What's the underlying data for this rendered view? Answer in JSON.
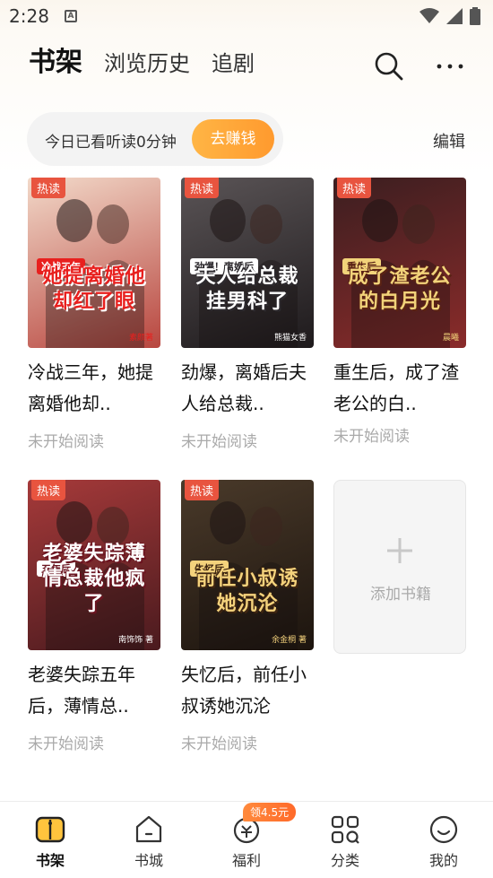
{
  "status_bar": {
    "time": "2:28",
    "notification_letter": "A"
  },
  "header": {
    "tabs": [
      {
        "label": "书架",
        "active": true
      },
      {
        "label": "浏览历史",
        "active": false
      },
      {
        "label": "追剧",
        "active": false
      }
    ],
    "search_icon": "search-icon",
    "more_icon": "more-icon"
  },
  "reading_bar": {
    "text": "今日已看听读0分钟",
    "earn_label": "去赚钱"
  },
  "edit_label": "编辑",
  "books": [
    {
      "badge": "热读",
      "cover_tag": "冷战三年",
      "cover_title": "她提离婚他却红了眼",
      "cover_author": "素颜著",
      "title": "冷战三年，她提离婚他却..",
      "status": "未开始阅读",
      "colors": {
        "bg1": "#f2d9c9",
        "bg2": "#b8463f",
        "title": "#e8201e",
        "stroke": "#ffffff"
      }
    },
    {
      "badge": "热读",
      "cover_tag": "劲爆！离婚后",
      "cover_title": "夫人给总裁挂男科了",
      "cover_author": "熊猫女香",
      "title": "劲爆，离婚后夫人给总裁..",
      "status": "未开始阅读",
      "colors": {
        "bg1": "#5a5456",
        "bg2": "#1e1a1c",
        "title": "#ffffff",
        "stroke": "#2d2a2e"
      }
    },
    {
      "badge": "热读",
      "cover_tag": "重生后",
      "cover_title": "成了渣老公的白月光",
      "cover_author": "晨曦",
      "title": "重生后，成了渣老公的白..",
      "status": "未开始阅读",
      "colors": {
        "bg1": "#3b1e20",
        "bg2": "#8a2b2a",
        "title": "#f2d37a",
        "stroke": "#5a2214"
      }
    },
    {
      "badge": "热读",
      "cover_tag": "五年后",
      "cover_title": "老婆失踪薄情总裁他疯了",
      "cover_author": "南饰饰 著",
      "title": "老婆失踪五年后，薄情总..",
      "status": "未开始阅读",
      "colors": {
        "bg1": "#a63a3a",
        "bg2": "#4a1a1e",
        "title": "#ffffff",
        "stroke": "#6b1420"
      }
    },
    {
      "badge": "热读",
      "cover_tag": "失忆后",
      "cover_title": "前任小叔诱她沉沦",
      "cover_author": "余金桐 著",
      "title": "失忆后，前任小叔诱她沉沦",
      "status": "未开始阅读",
      "colors": {
        "bg1": "#4a3a2a",
        "bg2": "#1c140e",
        "title": "#f4d27c",
        "stroke": "#3d2410"
      }
    }
  ],
  "add_book": {
    "label": "添加书籍"
  },
  "bottom_nav": {
    "items": [
      {
        "label": "书架",
        "icon": "bookshelf-icon",
        "active": true
      },
      {
        "label": "书城",
        "icon": "bookstore-icon",
        "active": false
      },
      {
        "label": "福利",
        "icon": "welfare-icon",
        "active": false
      },
      {
        "label": "分类",
        "icon": "category-icon",
        "active": false
      },
      {
        "label": "我的",
        "icon": "profile-icon",
        "active": false
      }
    ],
    "welfare_badge": "领4.5元"
  }
}
